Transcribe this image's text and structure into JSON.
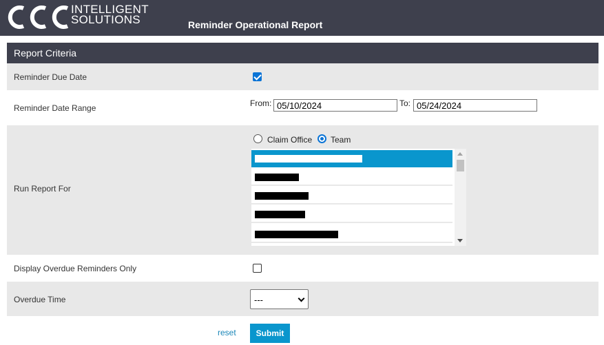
{
  "header": {
    "logo_line1": "INTELLIGENT",
    "logo_line2": "SOLUTIONS",
    "title": "Reminder Operational Report"
  },
  "panel": {
    "title": "Report Criteria"
  },
  "criteria": {
    "due_date_label": "Reminder Due Date",
    "due_date_checked": true,
    "date_range_label": "Reminder Date Range",
    "from_label": "From:",
    "from_value": "05/10/2024",
    "to_label": "To:",
    "to_value": "05/24/2024",
    "run_for_label": "Run Report For",
    "radio_claim_office": "Claim Office",
    "radio_team": "Team",
    "selected_radio": "Team",
    "overdue_only_label": "Display Overdue Reminders Only",
    "overdue_only_checked": false,
    "overdue_time_label": "Overdue Time",
    "overdue_time_value": "---"
  },
  "actions": {
    "reset_label": "reset",
    "submit_label": "Submit"
  },
  "colors": {
    "header_bg": "#3e404d",
    "accent": "#0a96cd",
    "row_grey": "#e8e8e8"
  }
}
